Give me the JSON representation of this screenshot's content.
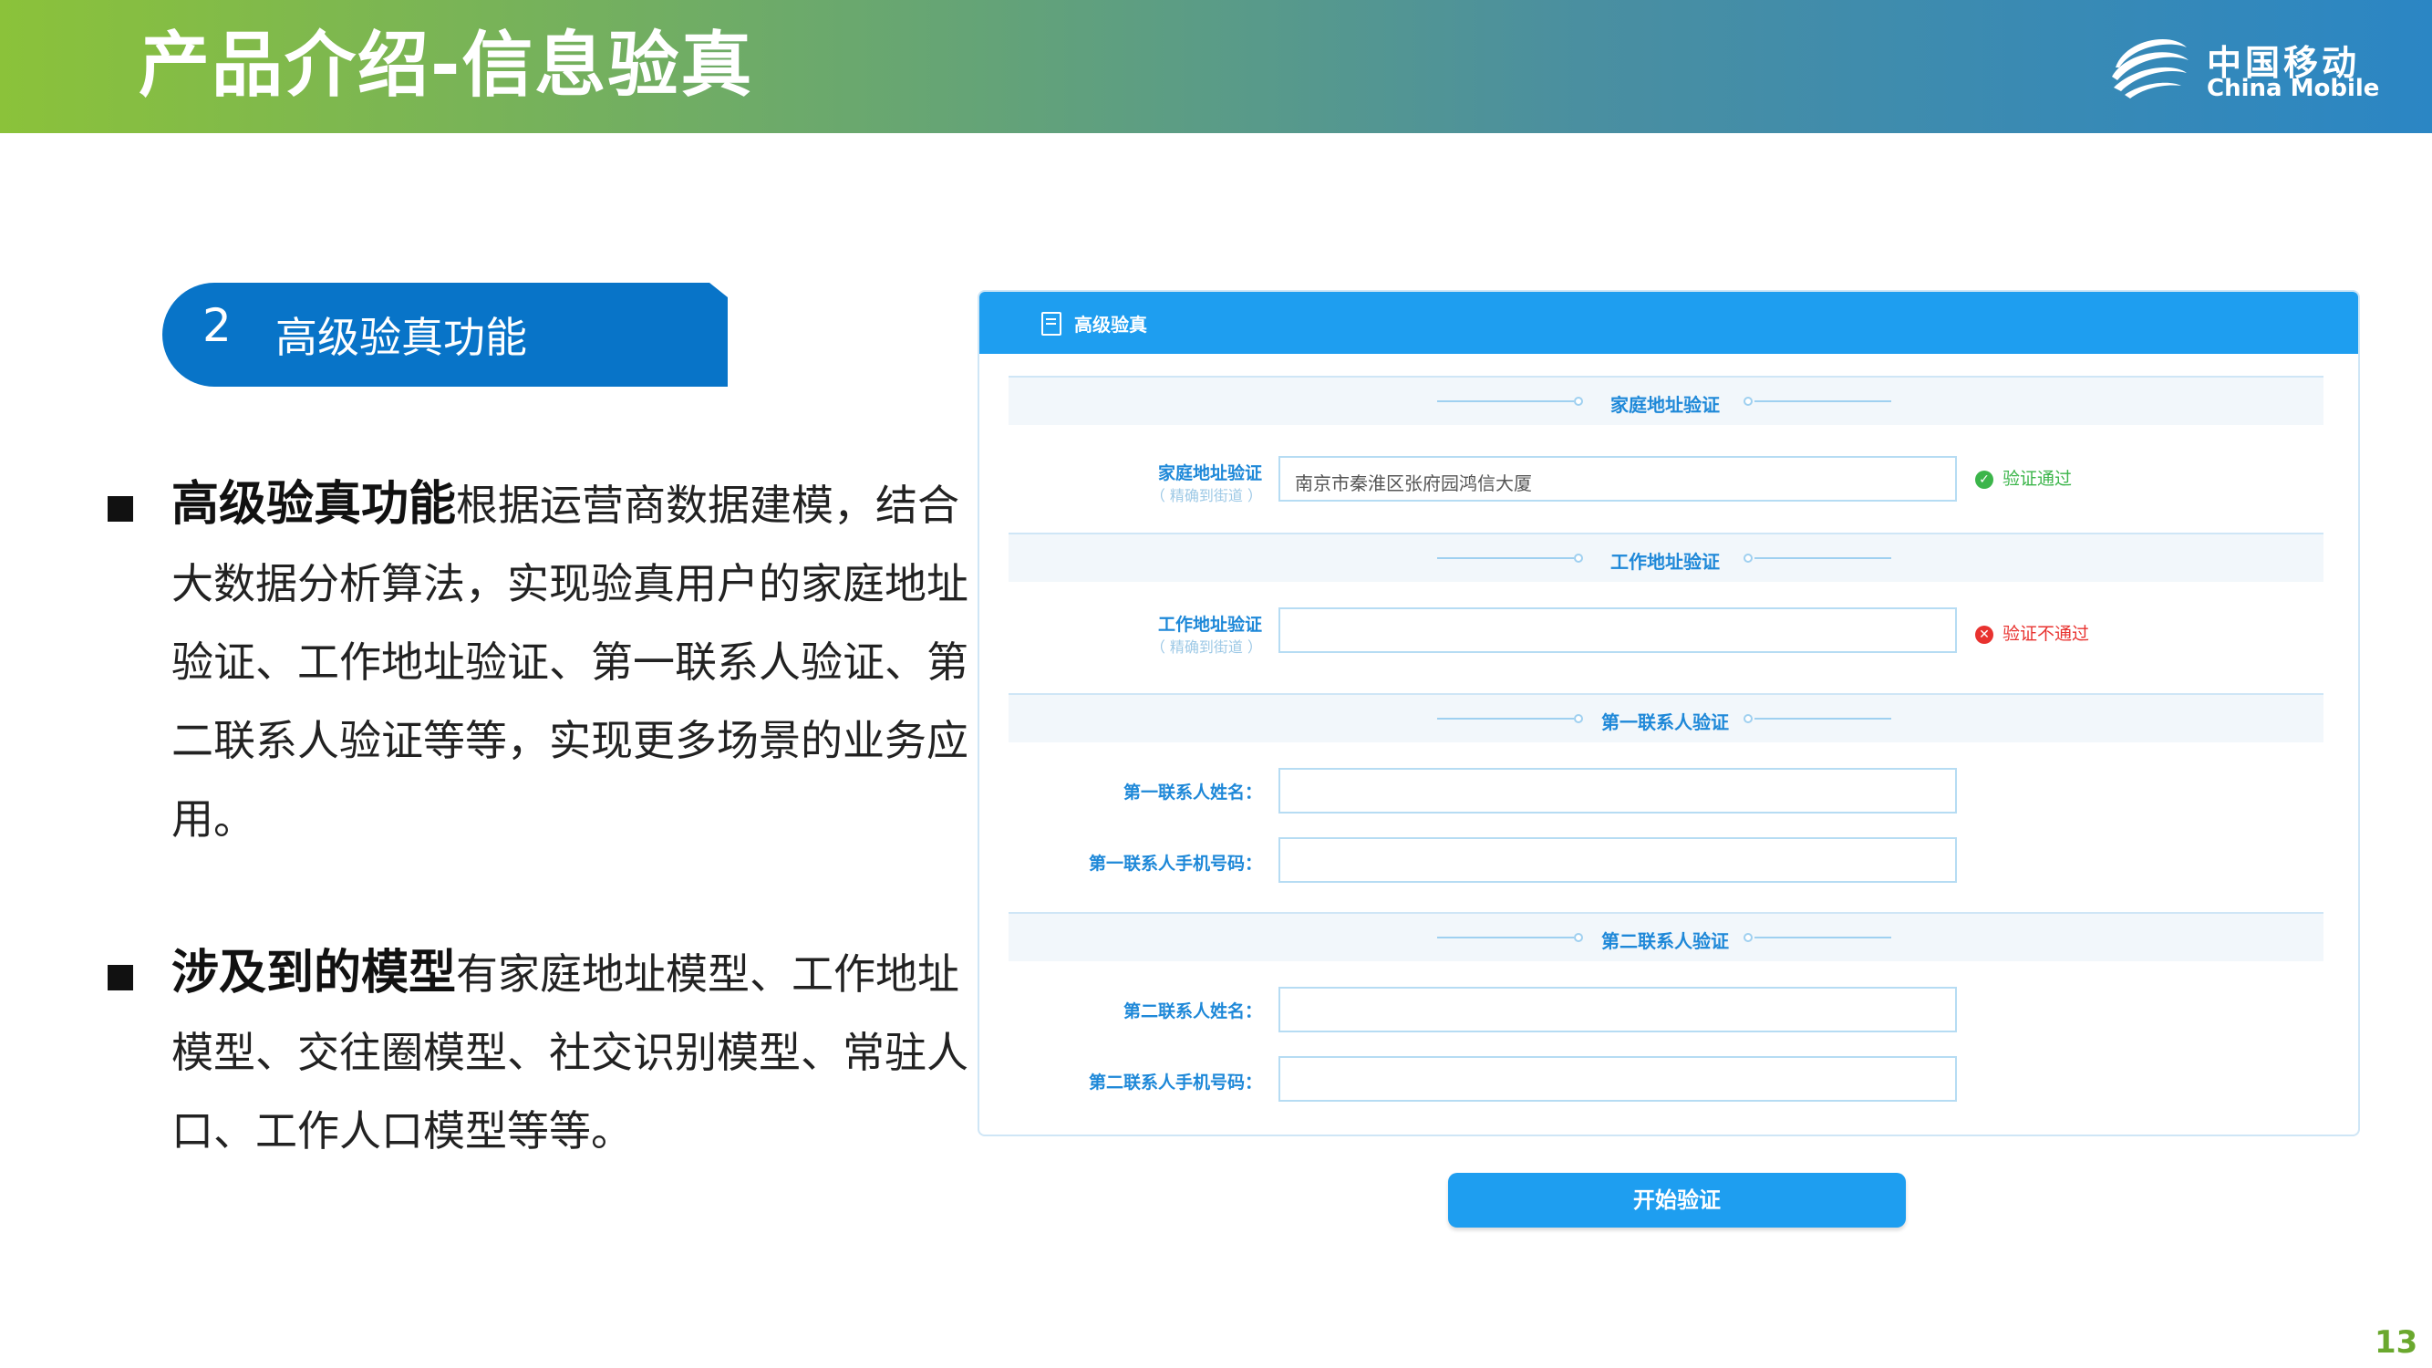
{
  "header": {
    "title": "产品介绍-信息验真"
  },
  "logo": {
    "cn": "中国移动",
    "en": "China Mobile"
  },
  "section": {
    "number": "2",
    "label": "高级验真功能"
  },
  "bullets": [
    {
      "bold": "高级验真功能",
      "text": "根据运营商数据建模，结合大数据分析算法，实现验真用户的家庭地址验证、工作地址验证、第一联系人验证、第二联系人验证等等，实现更多场景的业务应用。"
    },
    {
      "bold": "涉及到的模型",
      "text": "有家庭地址模型、工作地址模型、交往圈模型、社交识别模型、常驻人口、工作人口模型等等。"
    }
  ],
  "panel": {
    "title": "高级验真",
    "sections": {
      "home": "家庭地址验证",
      "work": "工作地址验证",
      "contact1": "第一联系人验证",
      "contact2": "第二联系人验证"
    },
    "fields": {
      "home_label": "家庭地址验证",
      "home_hint": "（ 精确到街道 ）",
      "home_value": "南京市秦淮区张府园鸿信大厦",
      "home_status": "验证通过",
      "work_label": "工作地址验证",
      "work_hint": "（ 精确到街道 ）",
      "work_value": "",
      "work_status": "验证不通过",
      "c1_name_label": "第一联系人姓名：",
      "c1_phone_label": "第一联系人手机号码：",
      "c2_name_label": "第二联系人姓名：",
      "c2_phone_label": "第二联系人手机号码："
    },
    "status_colors": {
      "ok": "#3bb54a",
      "bad": "#e8322f"
    },
    "button": "开始验证"
  },
  "page_number": "13"
}
